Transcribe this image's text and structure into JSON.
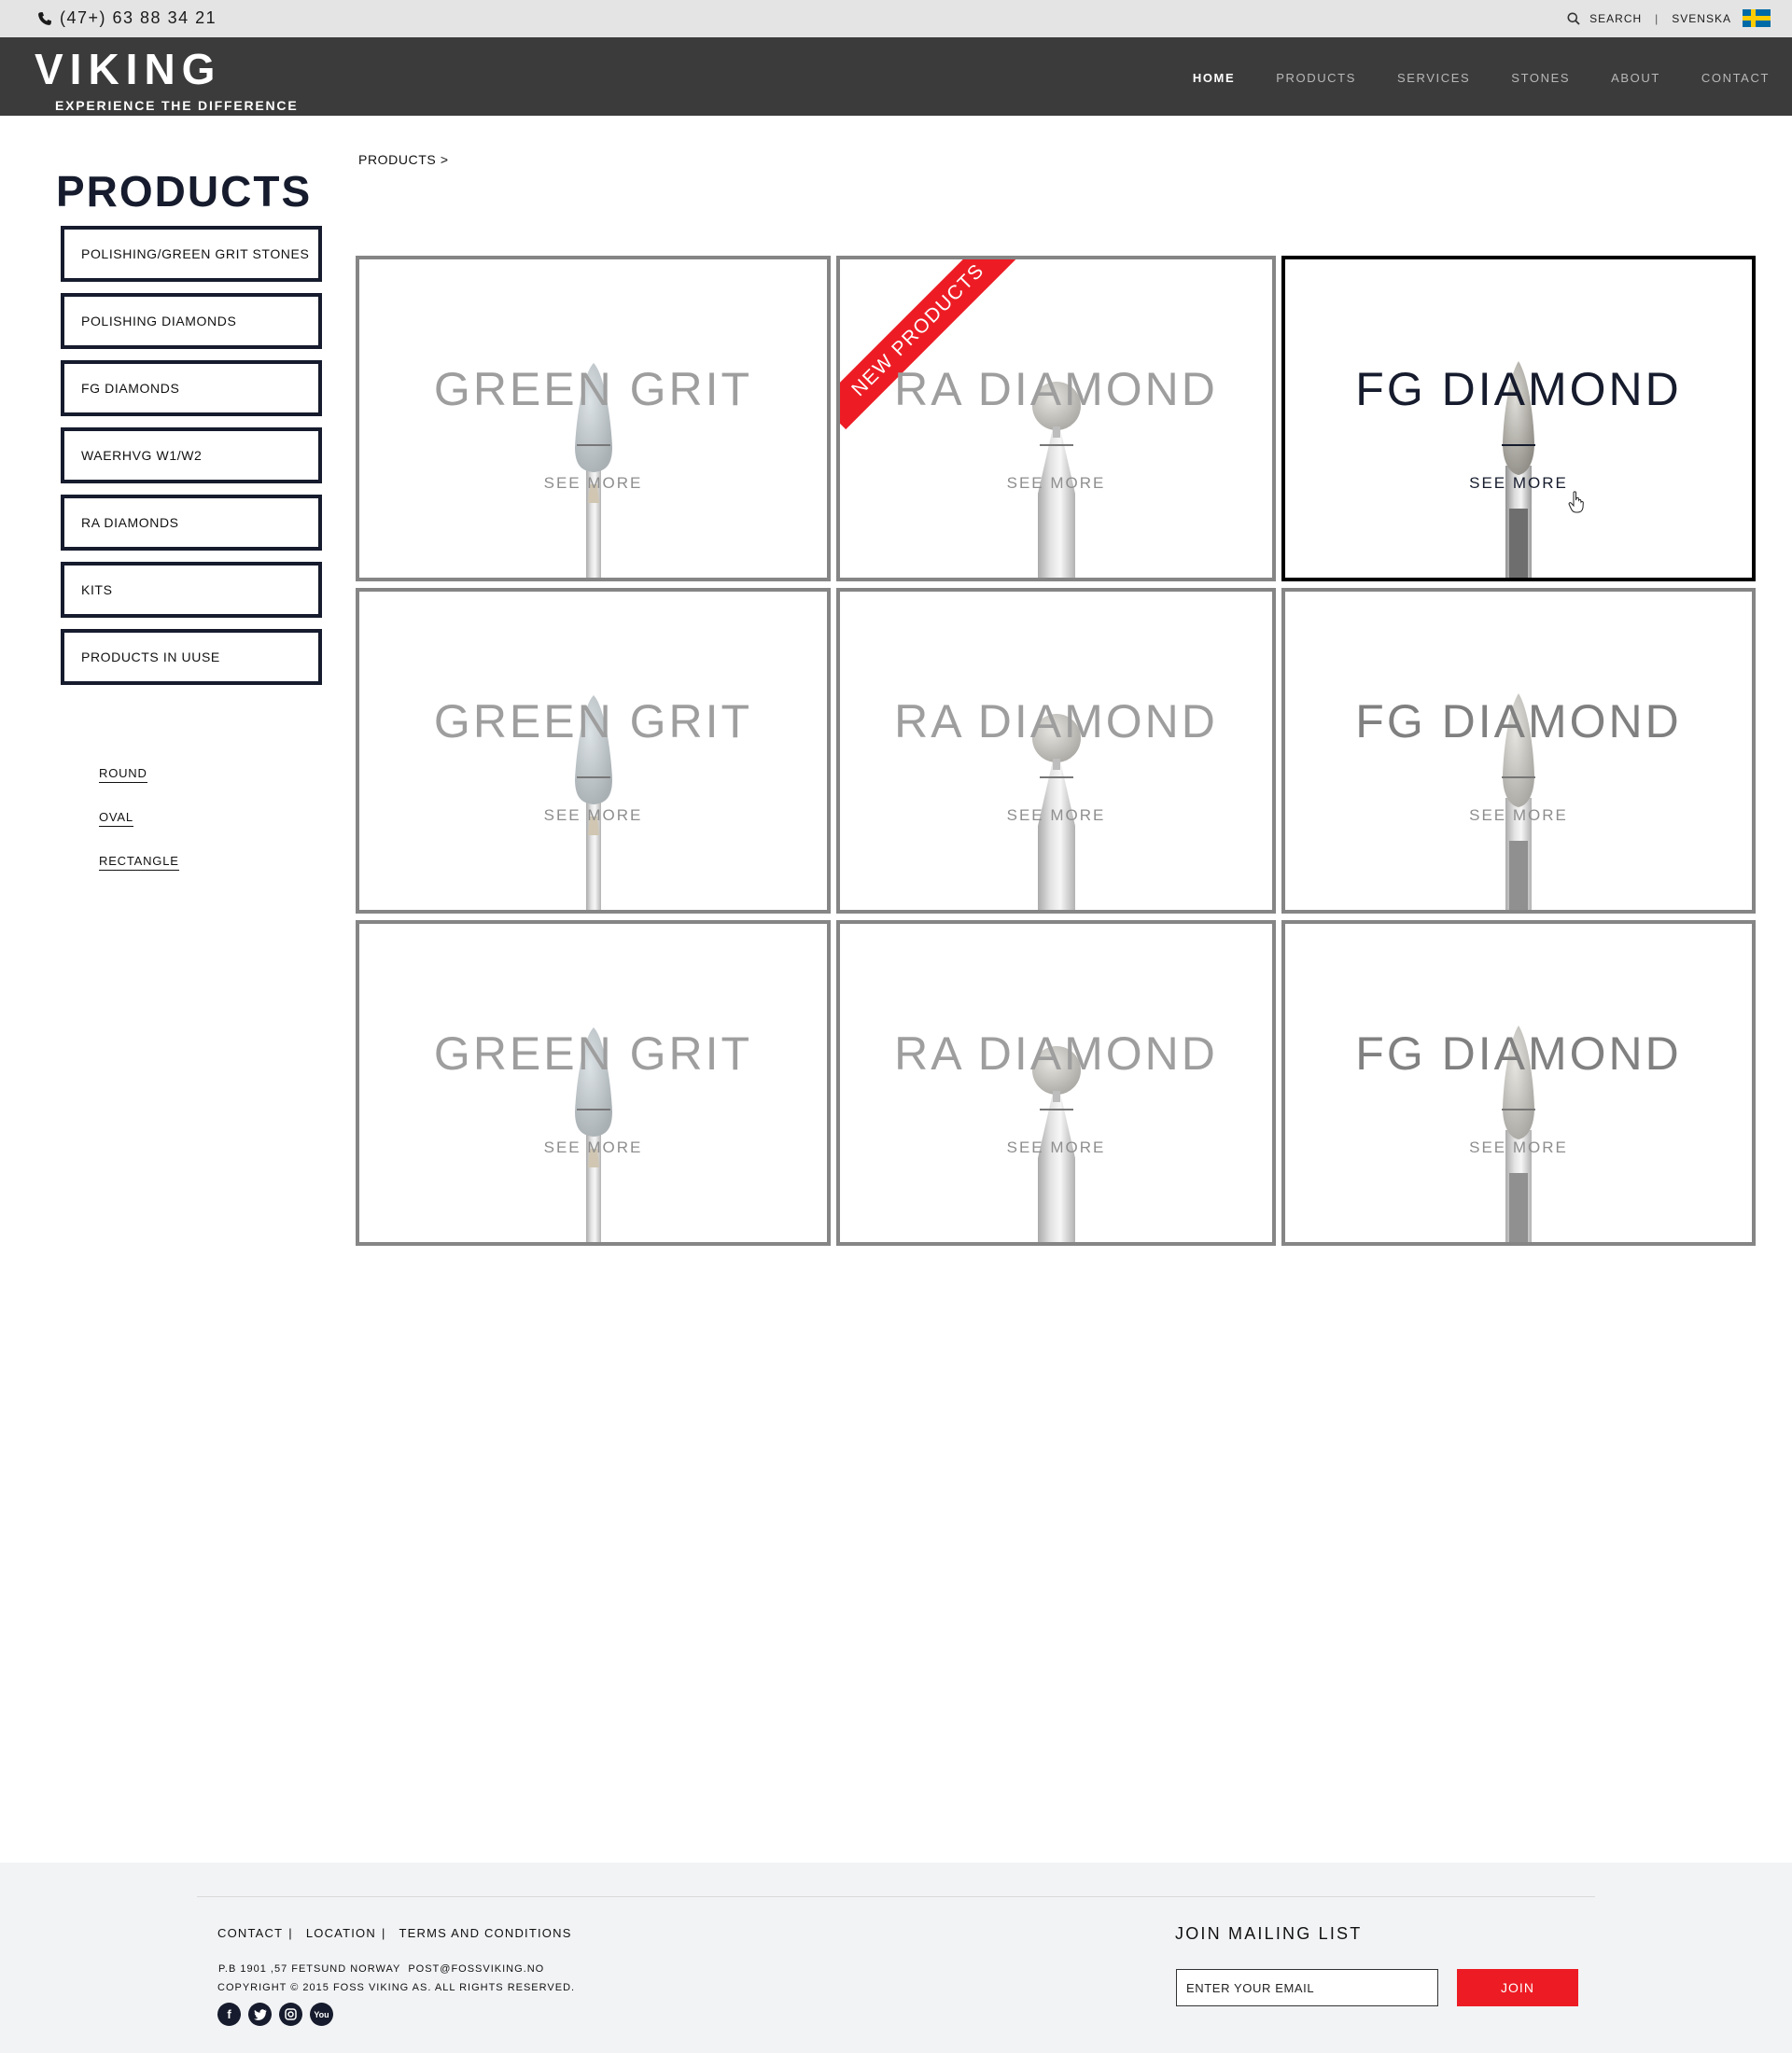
{
  "topbar": {
    "phone": "(47+) 63 88 34 21",
    "search_label": "SEARCH",
    "separator": "|",
    "language": "SVENSKA"
  },
  "header": {
    "logo_name": "VIKING",
    "logo_tagline": "EXPERIENCE THE DIFFERENCE",
    "nav": {
      "home": "HOME",
      "products": "PRODUCTS",
      "services": "SERVICES",
      "stones": "STONES",
      "about": "ABOUT",
      "contact": "CONTACT"
    },
    "active_nav": "HOME"
  },
  "sidebar": {
    "title": "PRODUCTS",
    "menu": [
      "POLISHING/GREEN GRIT STONES",
      "POLISHING DIAMONDS",
      "FG DIAMONDS",
      "WAERHVG W1/W2",
      "RA DIAMONDS",
      "KITS",
      "PRODUCTS IN UUSE"
    ],
    "filters": [
      "ROUND",
      "OVAL",
      "RECTANGLE"
    ]
  },
  "breadcrumb": "PRODUCTS >",
  "grid": {
    "see_more": "SEE MORE",
    "ribbon": "NEW PRODUCTS",
    "tiles": [
      {
        "title": "GREEN GRIT",
        "bur": "cone-stone-icon",
        "active": false
      },
      {
        "title": "RA DIAMOND",
        "bur": "ball-bur-icon",
        "active": false,
        "badge": true
      },
      {
        "title": "FG DIAMOND",
        "bur": "flame-bur-icon",
        "active": true
      },
      {
        "title": "GREEN GRIT",
        "bur": "cone-stone-icon",
        "active": false
      },
      {
        "title": "RA DIAMOND",
        "bur": "ball-bur-icon",
        "active": false
      },
      {
        "title": "FG DIAMOND",
        "bur": "flame-bur-icon",
        "active": false
      },
      {
        "title": "GREEN GRIT",
        "bur": "cone-stone-icon",
        "active": false
      },
      {
        "title": "RA DIAMOND",
        "bur": "ball-bur-icon",
        "active": false
      },
      {
        "title": "FG DIAMOND",
        "bur": "flame-bur-icon",
        "active": false
      }
    ]
  },
  "footer": {
    "links": [
      "CONTACT",
      "LOCATION",
      "TERMS AND CONDITIONS"
    ],
    "separator": "|",
    "address": "P.B 1901 ,57 FETSUND NORWAY",
    "email": "POST@FOSSVIKING.NO",
    "copyright": "COPYRIGHT © 2015 FOSS VIKING AS. ALL RIGHTS RESERVED.",
    "social": [
      "facebook-icon",
      "twitter-icon",
      "instagram-icon",
      "youtube-icon"
    ],
    "mailing_title": "JOIN MAILING LIST",
    "email_placeholder": "ENTER YOUR EMAIL",
    "join_label": "JOIN"
  },
  "colors": {
    "accent_red": "#ed1c24",
    "navy": "#161c2d",
    "header_bg": "#3b3b3b",
    "topbar_bg": "#e4e4e4"
  }
}
